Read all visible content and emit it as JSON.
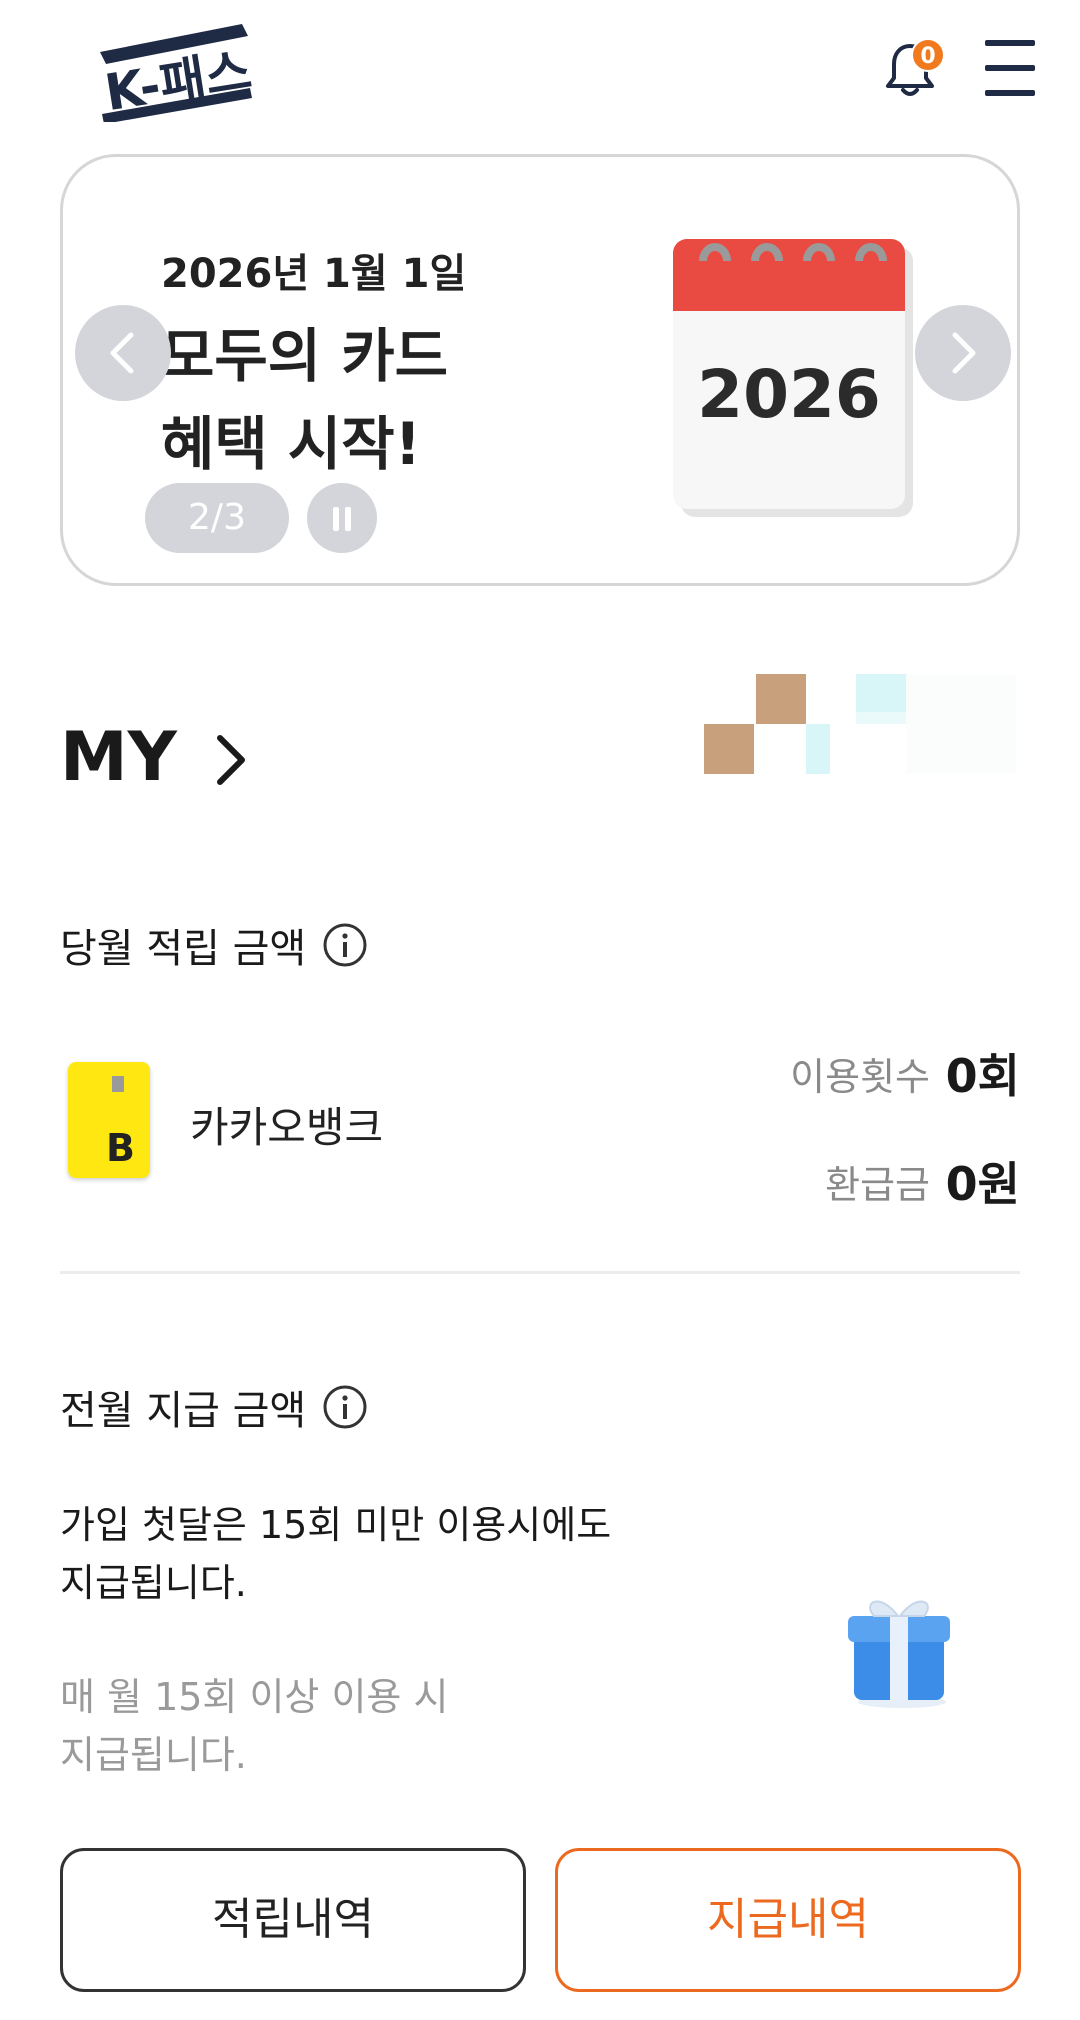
{
  "header": {
    "logo_text": "K-패스",
    "notification_count": "0",
    "bell_icon": "bell-icon",
    "menu_icon": "hamburger-menu-icon"
  },
  "banner": {
    "date": "2026년 1월 1일",
    "headline_line1": "모두의 카드",
    "headline_line2": "혜택 시작!",
    "calendar_year": "2026",
    "pager": "2/3",
    "prev_icon": "chevron-left-icon",
    "next_icon": "chevron-right-icon",
    "pause_icon": "pause-icon"
  },
  "my": {
    "title": "MY"
  },
  "monthly": {
    "label": "당월 적립 금액",
    "card_name": "카카오뱅크",
    "card_logo_letter": "B",
    "usage_label": "이용횟수",
    "usage_value": "0회",
    "refund_label": "환급금",
    "refund_value": "0원"
  },
  "previous": {
    "label": "전월 지급 금액",
    "notice_line1": "가입 첫달은 15회 미만 이용시에도",
    "notice_line2": "지급됩니다.",
    "sub_line1": "매 월 15회 이상 이용 시",
    "sub_line2": "지급됩니다."
  },
  "buttons": {
    "history": "적립내역",
    "payments": "지급내역"
  },
  "colors": {
    "accent": "#ec6a1f",
    "brand_navy": "#1f2a44",
    "kakao_yellow": "#ffe812"
  }
}
